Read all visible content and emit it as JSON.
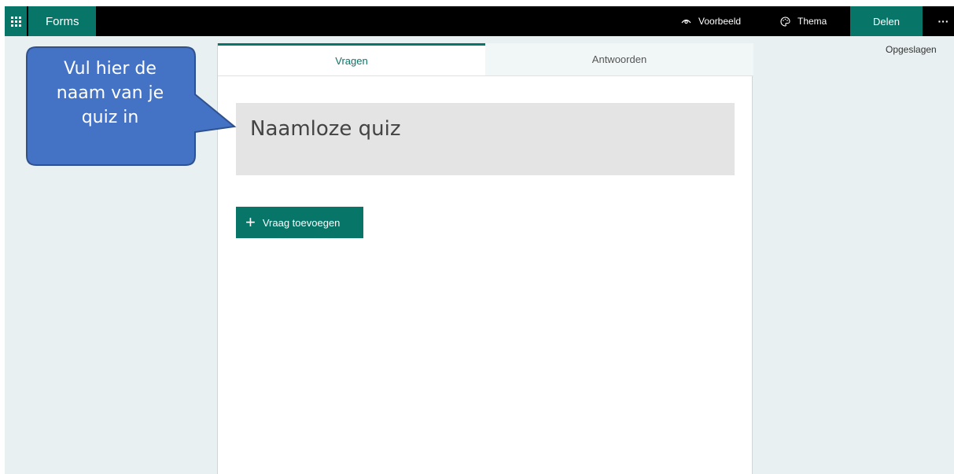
{
  "app": {
    "name": "Forms"
  },
  "topbar": {
    "preview_label": "Voorbeeld",
    "theme_label": "Thema",
    "share_label": "Delen",
    "more_label": "···"
  },
  "status": {
    "saved": "Opgeslagen"
  },
  "tabs": [
    {
      "label": "Vragen",
      "active": true
    },
    {
      "label": "Antwoorden",
      "active": false
    }
  ],
  "form": {
    "title": "Naamloze quiz",
    "add_question_label": "Vraag toevoegen"
  },
  "callout": {
    "lines": [
      "Vul hier de",
      "naam van je",
      "quiz in"
    ]
  },
  "icons": {
    "app_launcher": "waffle-icon",
    "preview": "eye-icon",
    "theme": "palette-icon",
    "add": "plus-icon"
  },
  "colors": {
    "brand": "#077568",
    "topbar": "#000000",
    "background": "#e9f0f2",
    "callout_fill": "#4472c4",
    "callout_border": "#2f528f"
  }
}
